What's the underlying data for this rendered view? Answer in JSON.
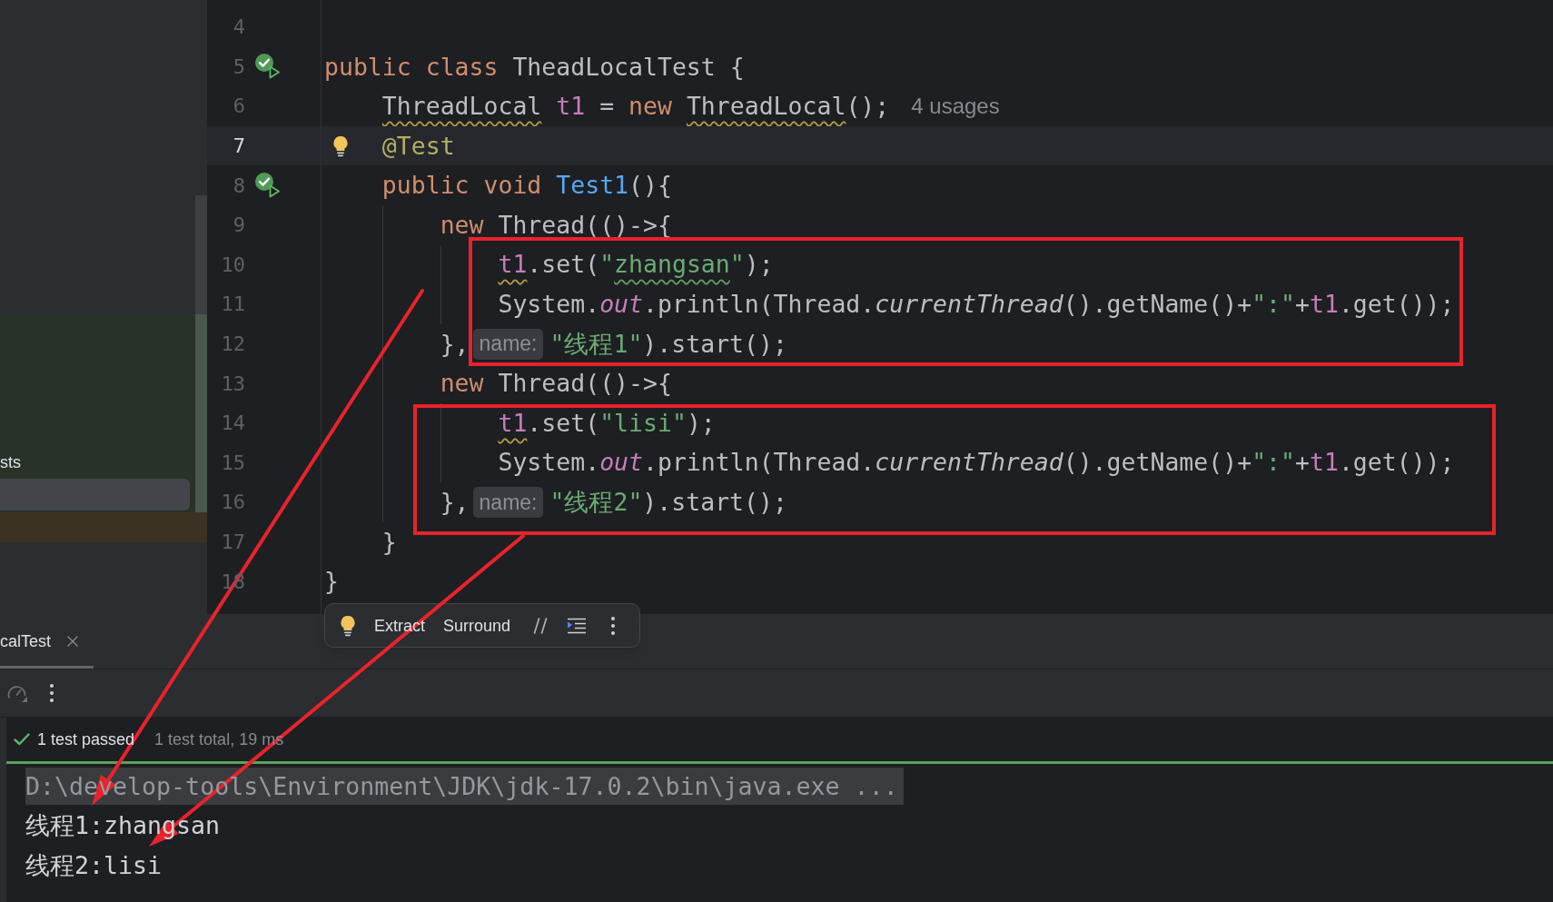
{
  "sidebar": {
    "rows": [
      {
        "label": "sts",
        "selected": false
      },
      {
        "selected": true
      }
    ]
  },
  "editor": {
    "lines": [
      {
        "number": "4",
        "current": false
      },
      {
        "number": "5",
        "current": false,
        "marker": {
          "kind": "run_passed"
        },
        "tokens": [
          {
            "kind": "keyword",
            "text": "public class"
          },
          {
            "kind": "plain",
            "text": " TheadLocalTest {"
          }
        ],
        "children": [
          {
            "number": "6",
            "current": false,
            "tokens": [
              {
                "kind": "plain",
                "text": "ThreadLocal",
                "squiggle": {
                  "kind": "warning"
                }
              },
              {
                "kind": "field",
                "text": " t1"
              },
              {
                "kind": "plain",
                "text": " = "
              },
              {
                "kind": "keyword",
                "text": "new "
              },
              {
                "kind": "plain",
                "text": "ThreadLocal",
                "squiggle": {
                  "kind": "warning"
                }
              },
              {
                "kind": "plain",
                "text": "();"
              },
              {
                "kind": "hint",
                "text": "4 usages"
              }
            ]
          },
          {
            "number": "7",
            "current": true,
            "marker": {
              "kind": "bulb"
            },
            "tokens": [
              {
                "kind": "annotation",
                "text": "@Test"
              }
            ]
          },
          {
            "number": "8",
            "current": false,
            "marker": {
              "kind": "run_passed"
            },
            "tokens": [
              {
                "kind": "keyword",
                "text": "public void "
              },
              {
                "kind": "method",
                "text": "Test1"
              },
              {
                "kind": "plain",
                "text": "(){"
              }
            ],
            "children": [
              {
                "number": "9",
                "current": false,
                "tokens": [
                  {
                    "kind": "keyword",
                    "text": "new "
                  },
                  {
                    "kind": "plain",
                    "text": "Thread(()->{"
                  }
                ],
                "children": [
                  {
                    "number": "10",
                    "current": false,
                    "tokens": [
                      {
                        "kind": "field",
                        "text": "t1",
                        "squiggle": {
                          "kind": "warning"
                        }
                      },
                      {
                        "kind": "plain",
                        "text": ".set("
                      },
                      {
                        "kind": "string",
                        "text": "\""
                      },
                      {
                        "kind": "string",
                        "text": "zhangsan",
                        "squiggle": {
                          "kind": "typo"
                        }
                      },
                      {
                        "kind": "string",
                        "text": "\""
                      },
                      {
                        "kind": "plain",
                        "text": ");"
                      }
                    ]
                  },
                  {
                    "number": "11",
                    "current": false,
                    "tokens": [
                      {
                        "kind": "plain",
                        "text": "System."
                      },
                      {
                        "kind": "static_field",
                        "text": "out"
                      },
                      {
                        "kind": "plain",
                        "text": ".println(Thread."
                      },
                      {
                        "kind": "static_call",
                        "text": "currentThread"
                      },
                      {
                        "kind": "plain",
                        "text": "().getName()+"
                      },
                      {
                        "kind": "string",
                        "text": "\":\""
                      },
                      {
                        "kind": "plain",
                        "text": "+"
                      },
                      {
                        "kind": "field",
                        "text": "t1"
                      },
                      {
                        "kind": "plain",
                        "text": ".get());"
                      }
                    ]
                  }
                ]
              },
              {
                "number": "12",
                "current": false,
                "tokens": [
                  {
                    "kind": "plain",
                    "text": "},"
                  },
                  {
                    "kind": "inlay",
                    "text": "name:"
                  },
                  {
                    "kind": "string",
                    "text": "\"线程1\""
                  },
                  {
                    "kind": "plain",
                    "text": ").start();"
                  }
                ]
              },
              {
                "number": "13",
                "current": false,
                "tokens": [
                  {
                    "kind": "keyword",
                    "text": "new "
                  },
                  {
                    "kind": "plain",
                    "text": "Thread(()->{"
                  }
                ],
                "children": [
                  {
                    "number": "14",
                    "current": false,
                    "tokens": [
                      {
                        "kind": "field",
                        "text": "t1",
                        "squiggle": {
                          "kind": "warning"
                        }
                      },
                      {
                        "kind": "plain",
                        "text": ".set("
                      },
                      {
                        "kind": "string",
                        "text": "\"lisi\""
                      },
                      {
                        "kind": "plain",
                        "text": ");"
                      }
                    ]
                  },
                  {
                    "number": "15",
                    "current": false,
                    "tokens": [
                      {
                        "kind": "plain",
                        "text": "System."
                      },
                      {
                        "kind": "static_field",
                        "text": "out"
                      },
                      {
                        "kind": "plain",
                        "text": ".println(Thread."
                      },
                      {
                        "kind": "static_call",
                        "text": "currentThread"
                      },
                      {
                        "kind": "plain",
                        "text": "().getName()+"
                      },
                      {
                        "kind": "string",
                        "text": "\":\""
                      },
                      {
                        "kind": "plain",
                        "text": "+"
                      },
                      {
                        "kind": "field",
                        "text": "t1"
                      },
                      {
                        "kind": "plain",
                        "text": ".get());"
                      }
                    ]
                  }
                ]
              },
              {
                "number": "16",
                "current": false,
                "tokens": [
                  {
                    "kind": "plain",
                    "text": "},"
                  },
                  {
                    "kind": "inlay",
                    "text": "name:"
                  },
                  {
                    "kind": "string",
                    "text": "\"线程2\""
                  },
                  {
                    "kind": "plain",
                    "text": ").start();"
                  }
                ]
              }
            ]
          },
          {
            "number": "17",
            "current": false,
            "tokens": [
              {
                "kind": "plain",
                "text": "}"
              }
            ]
          }
        ]
      },
      {
        "number": "18",
        "current": false,
        "tokens": [
          {
            "kind": "plain",
            "text": "}"
          }
        ]
      }
    ]
  },
  "intention_toolbar": {
    "items": [
      {
        "kind": "bulb"
      },
      {
        "kind": "action",
        "label": "Extract"
      },
      {
        "kind": "action",
        "label": "Surround"
      },
      {
        "kind": "comment"
      },
      {
        "kind": "reformat"
      },
      {
        "kind": "more"
      }
    ]
  },
  "run_panel": {
    "tabs": [
      {
        "label": "calTest",
        "selected": true,
        "closable": true
      }
    ],
    "toolbar": [
      {
        "kind": "gauge"
      },
      {
        "kind": "more"
      }
    ],
    "status": {
      "kind": "passed",
      "label": "1 test passed",
      "summary": "1 test total, 19 ms"
    },
    "progress": {
      "level": 1
    },
    "console": {
      "lines": [
        {
          "kind": "command",
          "text": "D:\\develop-tools\\Environment\\JDK\\jdk-17.0.2\\bin\\java.exe ..."
        },
        {
          "kind": "output",
          "text": "线程1:zhangsan"
        },
        {
          "kind": "output",
          "text": "线程2:lisi"
        }
      ]
    }
  },
  "annotations": [
    {
      "kind": "box"
    },
    {
      "kind": "box"
    },
    {
      "kind": "arrow"
    },
    {
      "kind": "arrow"
    }
  ]
}
